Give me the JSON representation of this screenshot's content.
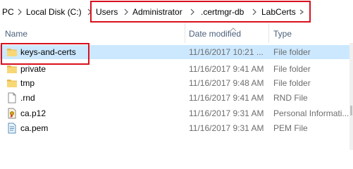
{
  "breadcrumb": {
    "items": [
      "PC",
      "Local Disk (C:)",
      "Users",
      "Administrator",
      ".certmgr-db",
      "LabCerts"
    ]
  },
  "columns": {
    "name": "Name",
    "date": "Date modified",
    "type": "Type"
  },
  "files": [
    {
      "name": "keys-and-certs",
      "date": "11/16/2017 10:21 ...",
      "type": "File folder",
      "icon": "folder-icon",
      "selected": true
    },
    {
      "name": "private",
      "date": "11/16/2017 9:41 AM",
      "type": "File folder",
      "icon": "folder-icon"
    },
    {
      "name": "tmp",
      "date": "11/16/2017 9:48 AM",
      "type": "File folder",
      "icon": "folder-icon"
    },
    {
      "name": ".rnd",
      "date": "11/16/2017 9:41 AM",
      "type": "RND File",
      "icon": "blank-file-icon"
    },
    {
      "name": "ca.p12",
      "date": "11/16/2017 9:31 AM",
      "type": "Personal Informati...",
      "icon": "certificate-file-icon"
    },
    {
      "name": "ca.pem",
      "date": "11/16/2017 9:31 AM",
      "type": "PEM File",
      "icon": "text-file-icon"
    }
  ],
  "colors": {
    "highlight": "#d9111e",
    "selection": "#cce8ff",
    "header_text": "#4c607a",
    "folder": "#f8d775"
  }
}
